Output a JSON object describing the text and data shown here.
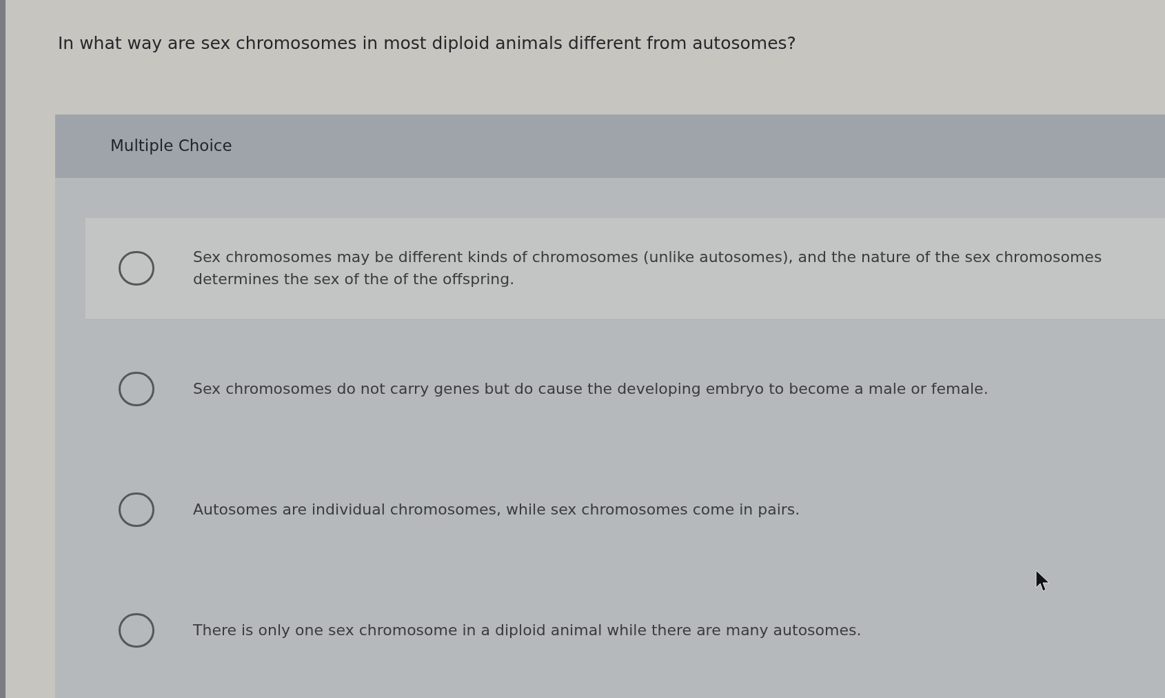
{
  "question": "In what way are sex chromosomes in most diploid animals different from autosomes?",
  "answer_panel": {
    "header": "Multiple Choice",
    "options": [
      {
        "text": "Sex chromosomes may be different kinds of chromosomes (unlike autosomes), and the nature of the sex chromosomes determines the sex of the of the offspring.",
        "selected": false,
        "highlighted": true
      },
      {
        "text": "Sex chromosomes do not carry genes but do cause the developing embryo to become a male or female.",
        "selected": false,
        "highlighted": false
      },
      {
        "text": "Autosomes are individual chromosomes, while sex chromosomes come in pairs.",
        "selected": false,
        "highlighted": false
      },
      {
        "text": "There is only one sex chromosome in a diploid animal while there are many autosomes.",
        "selected": false,
        "highlighted": false
      }
    ]
  }
}
